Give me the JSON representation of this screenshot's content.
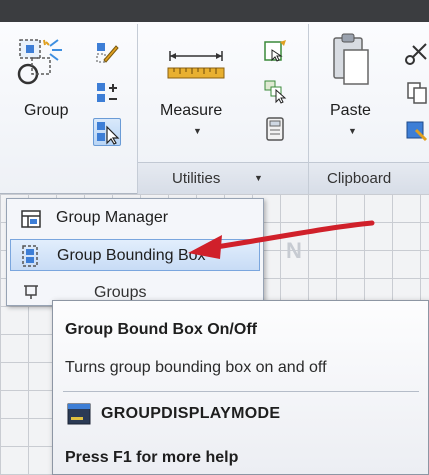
{
  "ribbon": {
    "group_panel": {
      "button_label": "Group"
    },
    "utilities_panel": {
      "measure_label": "Measure",
      "footer_label": "Utilities",
      "footer_caret": "▼"
    },
    "clipboard_panel": {
      "paste_label": "Paste",
      "footer_label": "Clipboard"
    }
  },
  "dropdown": {
    "items": [
      {
        "label": "Group Manager"
      },
      {
        "label": "Group Bounding Box"
      },
      {
        "label": "Groups"
      }
    ]
  },
  "tooltip": {
    "title": "Group Bound Box On/Off",
    "description": "Turns group bounding box on and off",
    "command": "GROUPDISPLAYMODE",
    "help": "Press F1 for more help"
  },
  "canvas": {
    "viewcube_letter": "N"
  },
  "colors": {
    "highlight": "#c8dcf6",
    "arrow": "#d0202a",
    "accent_blue": "#3d7ed6"
  }
}
